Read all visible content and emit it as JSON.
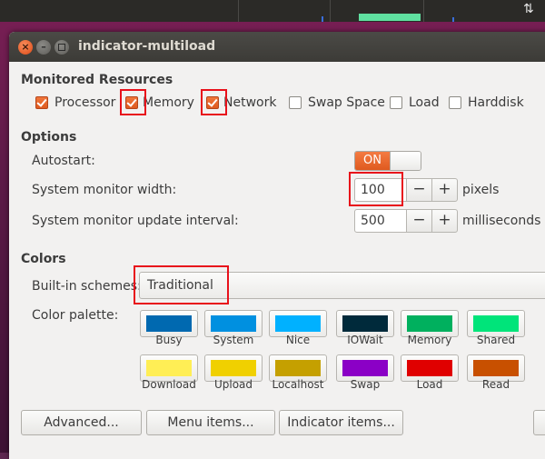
{
  "window": {
    "title": "indicator-multiload"
  },
  "monitored": {
    "title": "Monitored Resources",
    "items": [
      {
        "label": "Processor",
        "checked": true
      },
      {
        "label": "Memory",
        "checked": true
      },
      {
        "label": "Network",
        "checked": true
      },
      {
        "label": "Swap Space",
        "checked": false
      },
      {
        "label": "Load",
        "checked": false
      },
      {
        "label": "Harddisk",
        "checked": false
      }
    ]
  },
  "options": {
    "title": "Options",
    "autostart_label": "Autostart:",
    "autostart_state": "ON",
    "width_label": "System monitor width:",
    "width_value": "100",
    "width_unit": "pixels",
    "interval_label": "System monitor update interval:",
    "interval_value": "500",
    "interval_unit": "milliseconds",
    "minus": "−",
    "plus": "+"
  },
  "colors": {
    "title": "Colors",
    "schemes_label": "Built-in schemes:",
    "scheme_value": "Traditional",
    "palette_label": "Color palette:",
    "row1": [
      {
        "label": "Busy",
        "color": "#0069b0"
      },
      {
        "label": "System",
        "color": "#0090e0"
      },
      {
        "label": "Nice",
        "color": "#00b1ff"
      },
      {
        "label": "IOWait",
        "color": "#002a3b"
      },
      {
        "label": "Memory",
        "color": "#00b05e"
      },
      {
        "label": "Shared",
        "color": "#00e47a"
      }
    ],
    "row2": [
      {
        "label": "Download",
        "color": "#ffee55"
      },
      {
        "label": "Upload",
        "color": "#f0d000"
      },
      {
        "label": "Localhost",
        "color": "#c5a000"
      },
      {
        "label": "Swap",
        "color": "#8b00c6"
      },
      {
        "label": "Load",
        "color": "#e00000"
      },
      {
        "label": "Read",
        "color": "#c85000"
      }
    ]
  },
  "buttons": {
    "advanced": "Advanced...",
    "menu_items": "Menu items...",
    "indicator_items": "Indicator items..."
  }
}
